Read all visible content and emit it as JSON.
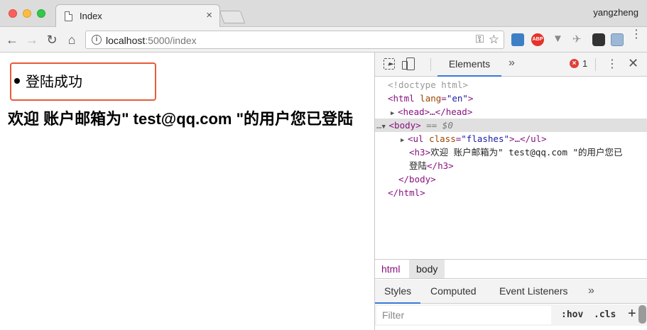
{
  "window": {
    "tab_title": "Index",
    "tab_close": "×",
    "profile_name": "yangzheng"
  },
  "toolbar": {
    "back": "←",
    "forward": "→",
    "reload": "↻",
    "home": "⌂",
    "url_host": "localhost",
    "url_path": ":5000/index",
    "info_icon": "i",
    "key_icon": "⚿",
    "star_icon": "☆",
    "ext_abp": "ABP",
    "menu": "⋮"
  },
  "page": {
    "flash_message": "登陆成功",
    "heading": "欢迎 账户邮箱为\" test@qq.com \"的用户您已登陆"
  },
  "devtools": {
    "tab_elements": "Elements",
    "tab_more": "»",
    "error_count": "1",
    "error_icon": "x-circle-icon",
    "menu": "⋮",
    "close": "✕",
    "dom": {
      "doctype": "<!doctype html>",
      "html_open_tag": "<html",
      "html_lang_attr": "lang",
      "html_lang_val": "\"en\"",
      "html_open_close": ">",
      "head_line": "<head>…</head>",
      "body_marker": "…",
      "body_tag": "<body>",
      "body_eq": " == $0",
      "ul_tag": "<ul",
      "ul_class_attr": "class",
      "ul_class_val": "\"flashes\"",
      "ul_rest": ">…</ul>",
      "h3_open": "<h3>",
      "h3_text_1": "欢迎 账户邮箱为\" test@qq.com \"的用户您已",
      "h3_text_2": "登陆",
      "h3_close": "</h3>",
      "body_close": "</body>",
      "html_close": "</html>"
    },
    "breadcrumbs": [
      "html",
      "body"
    ],
    "sub_tabs": {
      "styles": "Styles",
      "computed": "Computed",
      "listeners": "Event Listeners",
      "more": "»"
    },
    "filter": {
      "placeholder": "Filter",
      "hov": ":hov",
      "cls": ".cls",
      "add": "+"
    }
  }
}
